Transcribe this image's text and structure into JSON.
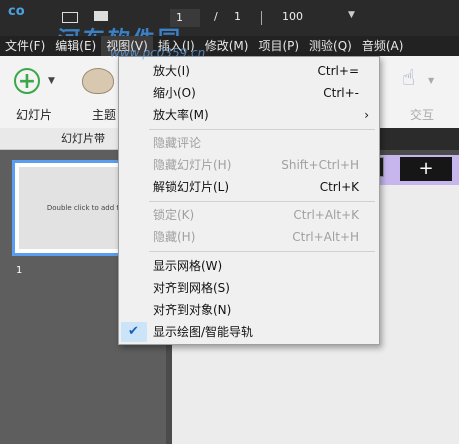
{
  "titlebar": {
    "logo": "co",
    "page_current": "1",
    "page_sep": "/",
    "page_total": "1",
    "zoom": "100",
    "watermark_line1": "河东软件园",
    "watermark_line2": "www.pc0359.cn"
  },
  "menubar": {
    "items": [
      "文件(F)",
      "编辑(E)",
      "视图(V)",
      "插入(I)",
      "修改(M)",
      "项目(P)",
      "测验(Q)",
      "音频(A)"
    ]
  },
  "ribbon": {
    "slide_label": "幻灯片",
    "theme_label": "主题",
    "interact_label": "交互"
  },
  "panel": {
    "header": "幻灯片带",
    "thumb_text": "Double click to add title",
    "thumb_number": "1"
  },
  "view_menu": {
    "items": [
      {
        "label": "放大(I)",
        "shortcut": "Ctrl+=",
        "disabled": false
      },
      {
        "label": "缩小(O)",
        "shortcut": "Ctrl+-",
        "disabled": false
      },
      {
        "label": "放大率(M)",
        "shortcut": "",
        "disabled": false,
        "submenu": true
      },
      {
        "label": "隐藏评论",
        "shortcut": "",
        "disabled": true
      },
      {
        "label": "隐藏幻灯片(H)",
        "shortcut": "Shift+Ctrl+H",
        "disabled": true
      },
      {
        "label": "解锁幻灯片(L)",
        "shortcut": "Ctrl+K",
        "disabled": false
      },
      {
        "label": "锁定(K)",
        "shortcut": "Ctrl+Alt+K",
        "disabled": true
      },
      {
        "label": "隐藏(H)",
        "shortcut": "Ctrl+Alt+H",
        "disabled": true
      },
      {
        "label": "显示网格(W)",
        "shortcut": "",
        "disabled": false
      },
      {
        "label": "对齐到网格(S)",
        "shortcut": "",
        "disabled": false
      },
      {
        "label": "对齐到对象(N)",
        "shortcut": "",
        "disabled": false
      },
      {
        "label": "显示绘图/智能导轨",
        "shortcut": "",
        "disabled": false,
        "checked": true
      }
    ]
  },
  "colors": {
    "accent": "#5b9df0",
    "app_dark": "#2a2a2a",
    "menu_bg": "#f0f0f0",
    "check_bg": "#cce4f7",
    "strip_purple": "#c7b6ee"
  }
}
